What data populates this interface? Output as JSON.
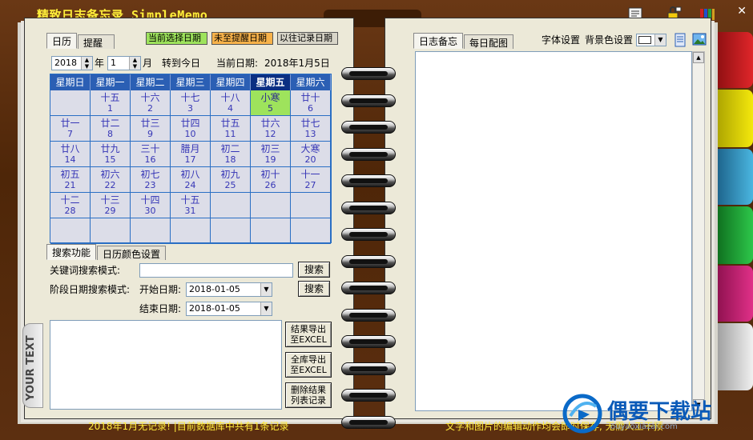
{
  "app": {
    "title": "精致日志备忘录 SimpleMemo",
    "side_text": "YOUR TEXT",
    "close_label": "✕"
  },
  "left_tabs": [
    "日历",
    "提醒"
  ],
  "legend": {
    "selected": "当前选择日期",
    "unreminded": "未至提醒日期",
    "recorded": "以往记录日期"
  },
  "date_controls": {
    "year": "2018",
    "year_label": "年",
    "month": "1",
    "month_label": "月",
    "goto_today": "转到今日",
    "current_date_label": "当前日期:",
    "current_date": "2018年1月5日"
  },
  "calendar": {
    "weekdays": [
      "星期日",
      "星期一",
      "星期二",
      "星期三",
      "星期四",
      "星期五",
      "星期六"
    ],
    "today_index": 5,
    "cells": [
      {
        "lunar": "",
        "day": ""
      },
      {
        "lunar": "十五",
        "day": "1"
      },
      {
        "lunar": "十六",
        "day": "2"
      },
      {
        "lunar": "十七",
        "day": "3"
      },
      {
        "lunar": "十八",
        "day": "4"
      },
      {
        "lunar": "小寒",
        "day": "5",
        "today": true
      },
      {
        "lunar": "廿十",
        "day": "6"
      },
      {
        "lunar": "廿一",
        "day": "7"
      },
      {
        "lunar": "廿二",
        "day": "8"
      },
      {
        "lunar": "廿三",
        "day": "9"
      },
      {
        "lunar": "廿四",
        "day": "10"
      },
      {
        "lunar": "廿五",
        "day": "11"
      },
      {
        "lunar": "廿六",
        "day": "12"
      },
      {
        "lunar": "廿七",
        "day": "13"
      },
      {
        "lunar": "廿八",
        "day": "14"
      },
      {
        "lunar": "廿九",
        "day": "15"
      },
      {
        "lunar": "三十",
        "day": "16"
      },
      {
        "lunar": "腊月",
        "day": "17"
      },
      {
        "lunar": "初二",
        "day": "18"
      },
      {
        "lunar": "初三",
        "day": "19"
      },
      {
        "lunar": "大寒",
        "day": "20"
      },
      {
        "lunar": "初五",
        "day": "21"
      },
      {
        "lunar": "初六",
        "day": "22"
      },
      {
        "lunar": "初七",
        "day": "23"
      },
      {
        "lunar": "初八",
        "day": "24"
      },
      {
        "lunar": "初九",
        "day": "25"
      },
      {
        "lunar": "初十",
        "day": "26"
      },
      {
        "lunar": "十一",
        "day": "27"
      },
      {
        "lunar": "十二",
        "day": "28"
      },
      {
        "lunar": "十三",
        "day": "29"
      },
      {
        "lunar": "十四",
        "day": "30"
      },
      {
        "lunar": "十五",
        "day": "31"
      },
      {
        "lunar": "",
        "day": ""
      },
      {
        "lunar": "",
        "day": ""
      },
      {
        "lunar": "",
        "day": ""
      },
      {
        "lunar": "",
        "day": ""
      },
      {
        "lunar": "",
        "day": ""
      },
      {
        "lunar": "",
        "day": ""
      },
      {
        "lunar": "",
        "day": ""
      },
      {
        "lunar": "",
        "day": ""
      },
      {
        "lunar": "",
        "day": ""
      },
      {
        "lunar": "",
        "day": ""
      }
    ]
  },
  "search_tabs": [
    "搜索功能",
    "日历颜色设置"
  ],
  "search": {
    "keyword_label": "关键词搜索模式:",
    "keyword_value": "",
    "search_button": "搜索",
    "range_label": "阶段日期搜索模式:",
    "start_label": "开始日期:",
    "start_value": "2018-01-05",
    "end_label": "结束日期:",
    "end_value": "2018-01-05",
    "search_button2": "搜索"
  },
  "action_buttons": {
    "export_results": [
      "结果导出",
      "至EXCEL"
    ],
    "export_all": [
      "全库导出",
      "至EXCEL"
    ],
    "delete_results": [
      "删除结果",
      "列表记录"
    ]
  },
  "right_tabs": [
    "日志备忘",
    "每日配图"
  ],
  "right_toolbar": {
    "font_settings": "字体设置",
    "bg_settings": "背景色设置"
  },
  "status": {
    "left": "2018年1月无记录! |目前数据库中共有1条记录",
    "right": "文字和图片的编辑动作均会即时保存, 无需人工干预"
  },
  "watermark": {
    "text": "偶要下载站",
    "url": "ouyaoxiazai.com"
  },
  "colors": {
    "title": "#ffef3a",
    "header_blue": "#2b5fb4",
    "today_green": "#9ee35c",
    "legend_selected": "#9ee35c",
    "legend_unreminded": "#f7b24a",
    "legend_recorded": "#d8d5c8"
  }
}
